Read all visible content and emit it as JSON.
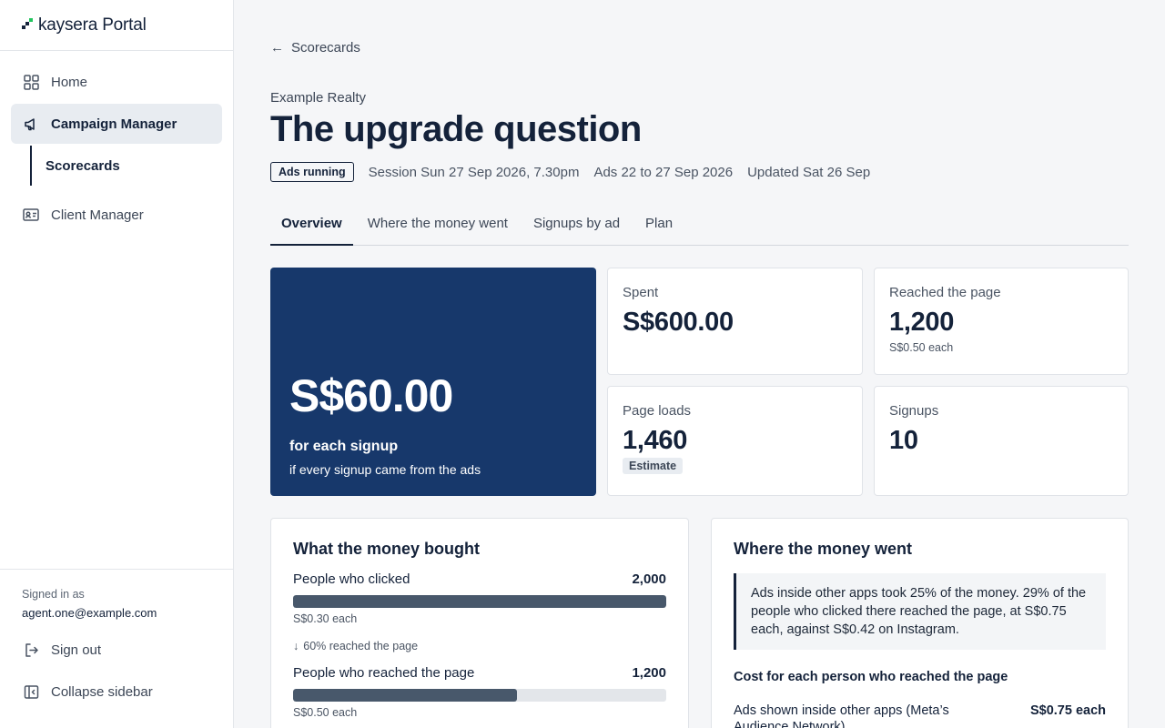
{
  "brand": {
    "name": "kaysera Portal",
    "accent": "#22c55e"
  },
  "sidebar": {
    "items": [
      {
        "label": "Home",
        "icon": "grid-icon"
      },
      {
        "label": "Campaign Manager",
        "icon": "megaphone-icon"
      },
      {
        "label": "Scorecards"
      },
      {
        "label": "Client Manager",
        "icon": "id-card-icon"
      }
    ],
    "signed_in_label": "Signed in as",
    "signed_in_email": "agent.one@example.com",
    "sign_out": "Sign out",
    "collapse": "Collapse sidebar"
  },
  "header": {
    "back_label": "Scorecards",
    "client": "Example Realty",
    "title": "The upgrade question",
    "status_badge": "Ads running",
    "session": "Session Sun 27 Sep 2026, 7.30pm",
    "ads_range": "Ads 22 to 27 Sep 2026",
    "updated": "Updated Sat 26 Sep"
  },
  "tabs": [
    "Overview",
    "Where the money went",
    "Signups by ad",
    "Plan"
  ],
  "hero": {
    "value": "S$60.00",
    "label": "for each signup",
    "sub": "if every signup came from the ads",
    "color": "#17386b"
  },
  "stats": {
    "spent": {
      "label": "Spent",
      "value": "S$600.00"
    },
    "reached": {
      "label": "Reached the page",
      "value": "1,200",
      "sub": "S$0.50 each"
    },
    "loads": {
      "label": "Page loads",
      "value": "1,460",
      "badge": "Estimate"
    },
    "signups": {
      "label": "Signups",
      "value": "10"
    }
  },
  "money_bought": {
    "title": "What the money bought",
    "rows": [
      {
        "label": "People who clicked",
        "value": "2,000",
        "note": "S$0.30 each",
        "fill": 1.0
      },
      {
        "label": "People who reached the page",
        "value": "1,200",
        "note": "S$0.50 each",
        "fill": 0.6
      }
    ],
    "drop_note": "60% reached the page"
  },
  "money_went": {
    "title": "Where the money went",
    "callout": "Ads inside other apps took 25% of the money. 29% of the people who clicked there reached the page, at S$0.75 each, against S$0.42 on Instagram.",
    "subhead": "Cost for each person who reached the page",
    "rows": [
      {
        "label": "Ads shown inside other apps (Meta’s Audience Network)",
        "value": "S$0.75 each"
      }
    ]
  }
}
